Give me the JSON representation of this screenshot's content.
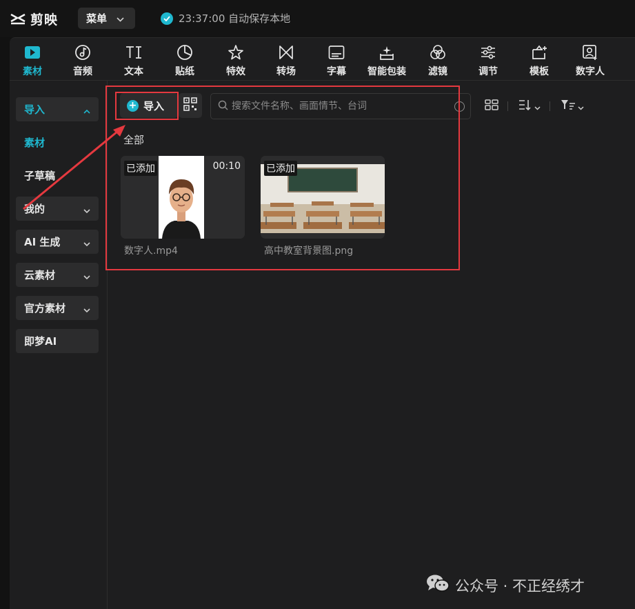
{
  "app": {
    "name": "剪映",
    "menu_label": "菜单",
    "save_status": "23:37:00 自动保存本地"
  },
  "tabs": [
    {
      "label": "素材",
      "icon": "media-play-icon",
      "active": true
    },
    {
      "label": "音频",
      "icon": "audio-note-icon"
    },
    {
      "label": "文本",
      "icon": "text-ti-icon"
    },
    {
      "label": "贴纸",
      "icon": "sticker-icon"
    },
    {
      "label": "特效",
      "icon": "effects-star-icon"
    },
    {
      "label": "转场",
      "icon": "transition-bowtie-icon"
    },
    {
      "label": "字幕",
      "icon": "caption-icon"
    },
    {
      "label": "智能包装",
      "icon": "smart-pack-icon"
    },
    {
      "label": "滤镜",
      "icon": "filter-circles-icon"
    },
    {
      "label": "调节",
      "icon": "adjust-sliders-icon"
    },
    {
      "label": "模板",
      "icon": "template-icon"
    },
    {
      "label": "数字人",
      "icon": "digital-human-icon"
    }
  ],
  "sidebar": {
    "items": [
      {
        "label": "导入",
        "expanded": true
      },
      {
        "label": "素材"
      },
      {
        "label": "子草稿"
      },
      {
        "label": "我的"
      },
      {
        "label": "AI 生成"
      },
      {
        "label": "云素材"
      },
      {
        "label": "官方素材"
      },
      {
        "label": "即梦AI"
      }
    ]
  },
  "toolbar": {
    "import_label": "导入",
    "search_placeholder": "搜索文件名称、画面情节、台词"
  },
  "section_title": "全部",
  "media": [
    {
      "name": "数字人.mp4",
      "badge": "已添加",
      "duration": "00:10"
    },
    {
      "name": "高中教室背景图.png",
      "badge": "已添加"
    }
  ],
  "watermark": "公众号 · 不正经绣才",
  "colors": {
    "accent": "#1fb8cf",
    "annotation": "#e5393f",
    "background": "#1e1e1f"
  }
}
